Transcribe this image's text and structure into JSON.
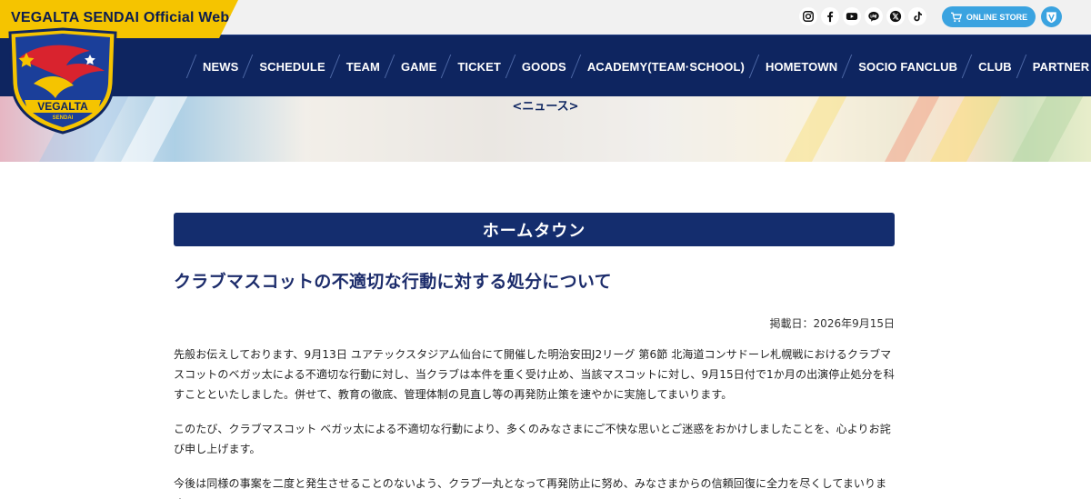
{
  "header": {
    "site_title": "VEGALTA SENDAI Official Website",
    "social_icons": [
      "instagram-icon",
      "facebook-icon",
      "youtube-icon",
      "line-icon",
      "x-icon",
      "tiktok-icon"
    ],
    "online_store_label": "ONLINE STORE",
    "logo_text": "VEGALTA",
    "logo_subtext": "SENDAI"
  },
  "nav": {
    "items": [
      "NEWS",
      "SCHEDULE",
      "TEAM",
      "GAME",
      "TICKET",
      "GOODS",
      "ACADEMY(TEAM·SCHOOL)",
      "HOMETOWN",
      "SOCIO FANCLUB",
      "CLUB",
      "PARTNER"
    ]
  },
  "hero": {
    "heading": "<ニュース>"
  },
  "article": {
    "category": "ホームタウン",
    "title": "クラブマスコットの不適切な行動に対する処分について",
    "date": "掲載日：2026年9月15日",
    "paragraphs": [
      "先般お伝えしております、9月13日 ユアテックスタジアム仙台にて開催した明治安田J2リーグ 第6節 北海道コンサドーレ札幌戦におけるクラブマスコットのベガッ太による不適切な行動に対し、当クラブは本件を重く受け止め、当該マスコットに対し、9月15日付で1か月の出演停止処分を科すことといたしました。併せて、教育の徹底、管理体制の見直し等の再発防止策を速やかに実施してまいります。",
      "このたび、クラブマスコット ベガッ太による不適切な行動により、多くのみなさまにご不快な思いとご迷惑をおかけしましたことを、心よりお詫び申し上げます。",
      "今後は同様の事案を二度と発生させることのないよう、クラブ一丸となって再発防止に努め、みなさまからの信頼回復に全力を尽くしてまいります。"
    ]
  },
  "colors": {
    "brand_yellow": "#f5c400",
    "navy": "#0e2560",
    "category_bar": "#142d6e",
    "title_text": "#1c2c6b",
    "store_blue": "#3aa3e0"
  }
}
